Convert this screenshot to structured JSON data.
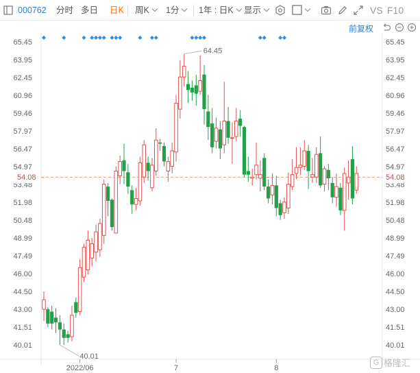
{
  "toolbar": {
    "panel_icon": "panel-toggle-icon",
    "stock_code": "000762",
    "tab_intraday": "分时",
    "tab_multiday": "多日",
    "tab_daily": "日K",
    "period_select": "周K",
    "minute_select": "1分",
    "range_select": "1年 : 日K",
    "display_select": "显示",
    "icons": [
      "settings-icon",
      "checkbox-icon",
      "camera-icon",
      "pencil-icon",
      "expand-icon"
    ],
    "vs_label": "VS",
    "f10_label": "F10"
  },
  "subbar": {
    "restore_rights": "前复权",
    "icons": [
      "undo-icon",
      "zoom-out-icon",
      "zoom-in-icon",
      "fullscreen-icon"
    ]
  },
  "price_axis": {
    "labels": [
      "65.45",
      "63.95",
      "62.45",
      "60.96",
      "59.46",
      "57.97",
      "56.47",
      "54.97",
      "53.48",
      "51.98",
      "50.48",
      "48.99",
      "47.49",
      "46.00",
      "44.50",
      "43.00",
      "41.51",
      "40.01"
    ],
    "current_price": "54.08"
  },
  "time_axis": {
    "labels": [
      "2022/06",
      "7",
      "8"
    ]
  },
  "annotations": {
    "high": "64.45",
    "low": "40.01"
  },
  "watermark": "格隆汇",
  "colors": {
    "up": "#e05050",
    "down": "#22a04a",
    "accent": "#ff6a00",
    "link": "#2a7fd4",
    "event_marker": "#2a8ee8"
  },
  "chart_data": {
    "type": "candlestick",
    "ylim": [
      40.01,
      65.45
    ],
    "x_ticks": [
      "2022/06",
      "7",
      "8"
    ],
    "candles": [
      {
        "o": 43.0,
        "c": 43.8,
        "h": 44.5,
        "l": 42.0
      },
      {
        "o": 43.0,
        "c": 41.8,
        "h": 43.2,
        "l": 41.5
      },
      {
        "o": 42.8,
        "c": 41.8,
        "h": 43.3,
        "l": 41.3
      },
      {
        "o": 42.3,
        "c": 41.9,
        "h": 43.1,
        "l": 41.0
      },
      {
        "o": 41.9,
        "c": 41.3,
        "h": 42.5,
        "l": 40.0
      },
      {
        "o": 41.3,
        "c": 40.6,
        "h": 41.8,
        "l": 40.0
      },
      {
        "o": 40.9,
        "c": 40.6,
        "h": 41.2,
        "l": 40.2
      },
      {
        "o": 40.7,
        "c": 42.5,
        "h": 43.3,
        "l": 40.3
      },
      {
        "o": 43.6,
        "c": 42.7,
        "h": 44.0,
        "l": 42.3
      },
      {
        "o": 42.8,
        "c": 46.5,
        "h": 47.2,
        "l": 42.5
      },
      {
        "o": 45.7,
        "c": 48.2,
        "h": 48.5,
        "l": 45.3
      },
      {
        "o": 46.3,
        "c": 48.8,
        "h": 49.6,
        "l": 45.9
      },
      {
        "o": 47.3,
        "c": 48.5,
        "h": 49.0,
        "l": 46.6
      },
      {
        "o": 47.8,
        "c": 49.5,
        "h": 50.1,
        "l": 47.0
      },
      {
        "o": 48.0,
        "c": 50.2,
        "h": 50.6,
        "l": 47.4
      },
      {
        "o": 49.2,
        "c": 53.5,
        "h": 53.9,
        "l": 48.5
      },
      {
        "o": 53.3,
        "c": 52.1,
        "h": 53.6,
        "l": 50.8
      },
      {
        "o": 52.2,
        "c": 49.9,
        "h": 52.3,
        "l": 49.6
      },
      {
        "o": 49.4,
        "c": 54.6,
        "h": 55.0,
        "l": 49.4
      },
      {
        "o": 54.2,
        "c": 55.4,
        "h": 55.9,
        "l": 53.5
      },
      {
        "o": 55.5,
        "c": 54.6,
        "h": 56.9,
        "l": 53.5
      },
      {
        "o": 54.5,
        "c": 53.3,
        "h": 55.2,
        "l": 52.7
      },
      {
        "o": 53.0,
        "c": 51.8,
        "h": 53.4,
        "l": 51.0
      },
      {
        "o": 51.8,
        "c": 52.3,
        "h": 53.2,
        "l": 51.3
      },
      {
        "o": 52.1,
        "c": 55.3,
        "h": 55.8,
        "l": 51.7
      },
      {
        "o": 54.1,
        "c": 56.8,
        "h": 57.2,
        "l": 53.6
      },
      {
        "o": 55.3,
        "c": 54.6,
        "h": 55.8,
        "l": 53.8
      },
      {
        "o": 53.2,
        "c": 55.1,
        "h": 55.7,
        "l": 52.9
      },
      {
        "o": 54.6,
        "c": 57.2,
        "h": 58.2,
        "l": 54.2
      },
      {
        "o": 57.0,
        "c": 56.9,
        "h": 57.3,
        "l": 56.3
      },
      {
        "o": 56.7,
        "c": 55.4,
        "h": 57.0,
        "l": 55.0
      },
      {
        "o": 54.6,
        "c": 55.4,
        "h": 55.8,
        "l": 53.7
      },
      {
        "o": 55.0,
        "c": 56.3,
        "h": 57.0,
        "l": 54.4
      },
      {
        "o": 56.2,
        "c": 60.3,
        "h": 61.0,
        "l": 55.4
      },
      {
        "o": 59.8,
        "c": 62.5,
        "h": 63.9,
        "l": 59.0
      },
      {
        "o": 62.5,
        "c": 63.4,
        "h": 64.45,
        "l": 61.7
      },
      {
        "o": 61.9,
        "c": 61.4,
        "h": 63.0,
        "l": 60.3
      },
      {
        "o": 61.6,
        "c": 61.2,
        "h": 62.2,
        "l": 60.5
      },
      {
        "o": 61.8,
        "c": 61.1,
        "h": 62.7,
        "l": 60.1
      },
      {
        "o": 61.3,
        "c": 62.2,
        "h": 64.3,
        "l": 61.0
      },
      {
        "o": 62.7,
        "c": 59.8,
        "h": 63.5,
        "l": 58.5
      },
      {
        "o": 59.6,
        "c": 58.3,
        "h": 61.0,
        "l": 57.2
      },
      {
        "o": 58.6,
        "c": 56.6,
        "h": 59.9,
        "l": 56.1
      },
      {
        "o": 57.1,
        "c": 58.2,
        "h": 59.1,
        "l": 56.5
      },
      {
        "o": 58.1,
        "c": 56.5,
        "h": 58.8,
        "l": 55.6
      },
      {
        "o": 56.8,
        "c": 58.8,
        "h": 62.1,
        "l": 56.1
      },
      {
        "o": 58.8,
        "c": 57.4,
        "h": 60.0,
        "l": 56.9
      },
      {
        "o": 57.4,
        "c": 57.4,
        "h": 58.7,
        "l": 55.2
      },
      {
        "o": 57.5,
        "c": 58.8,
        "h": 59.9,
        "l": 57.1
      },
      {
        "o": 59.0,
        "c": 58.4,
        "h": 59.7,
        "l": 57.5
      },
      {
        "o": 58.3,
        "c": 54.3,
        "h": 58.4,
        "l": 54.1
      },
      {
        "o": 54.6,
        "c": 54.3,
        "h": 55.8,
        "l": 53.7
      },
      {
        "o": 54.0,
        "c": 54.1,
        "h": 54.8,
        "l": 53.4
      },
      {
        "o": 54.3,
        "c": 55.1,
        "h": 57.0,
        "l": 53.9
      },
      {
        "o": 54.0,
        "c": 54.3,
        "h": 55.5,
        "l": 52.9
      },
      {
        "o": 55.7,
        "c": 53.3,
        "h": 56.1,
        "l": 53.0
      },
      {
        "o": 53.3,
        "c": 52.3,
        "h": 53.9,
        "l": 51.9
      },
      {
        "o": 52.6,
        "c": 53.4,
        "h": 54.4,
        "l": 51.8
      },
      {
        "o": 53.4,
        "c": 51.5,
        "h": 54.2,
        "l": 50.8
      },
      {
        "o": 51.9,
        "c": 50.9,
        "h": 52.2,
        "l": 50.5
      },
      {
        "o": 51.1,
        "c": 52.0,
        "h": 52.4,
        "l": 50.6
      },
      {
        "o": 51.5,
        "c": 53.5,
        "h": 54.5,
        "l": 51.0
      },
      {
        "o": 53.3,
        "c": 54.3,
        "h": 55.6,
        "l": 53.0
      },
      {
        "o": 54.4,
        "c": 54.9,
        "h": 56.6,
        "l": 53.9
      },
      {
        "o": 54.9,
        "c": 55.1,
        "h": 56.6,
        "l": 54.3
      },
      {
        "o": 55.0,
        "c": 56.3,
        "h": 57.2,
        "l": 54.7
      },
      {
        "o": 56.3,
        "c": 54.6,
        "h": 56.8,
        "l": 53.1
      },
      {
        "o": 54.1,
        "c": 54.3,
        "h": 55.7,
        "l": 53.6
      },
      {
        "o": 54.1,
        "c": 56.0,
        "h": 56.6,
        "l": 53.6
      },
      {
        "o": 56.1,
        "c": 53.4,
        "h": 57.5,
        "l": 53.2
      },
      {
        "o": 53.5,
        "c": 54.8,
        "h": 55.0,
        "l": 52.9
      },
      {
        "o": 54.7,
        "c": 54.0,
        "h": 55.2,
        "l": 53.0
      },
      {
        "o": 53.6,
        "c": 52.4,
        "h": 54.1,
        "l": 51.9
      },
      {
        "o": 52.4,
        "c": 53.3,
        "h": 54.4,
        "l": 51.6
      },
      {
        "o": 53.2,
        "c": 51.3,
        "h": 53.6,
        "l": 50.9
      },
      {
        "o": 51.3,
        "c": 54.4,
        "h": 54.9,
        "l": 49.6
      },
      {
        "o": 53.6,
        "c": 54.1,
        "h": 55.5,
        "l": 52.2
      },
      {
        "o": 55.6,
        "c": 52.3,
        "h": 56.7,
        "l": 51.8
      },
      {
        "o": 53.0,
        "c": 54.4,
        "h": 55.0,
        "l": 52.7
      }
    ],
    "event_marker_columns": [
      0,
      5,
      10,
      12,
      13,
      14,
      15,
      17,
      18,
      19,
      24,
      27,
      28,
      37,
      38,
      39,
      40,
      54,
      55,
      59,
      60
    ]
  }
}
